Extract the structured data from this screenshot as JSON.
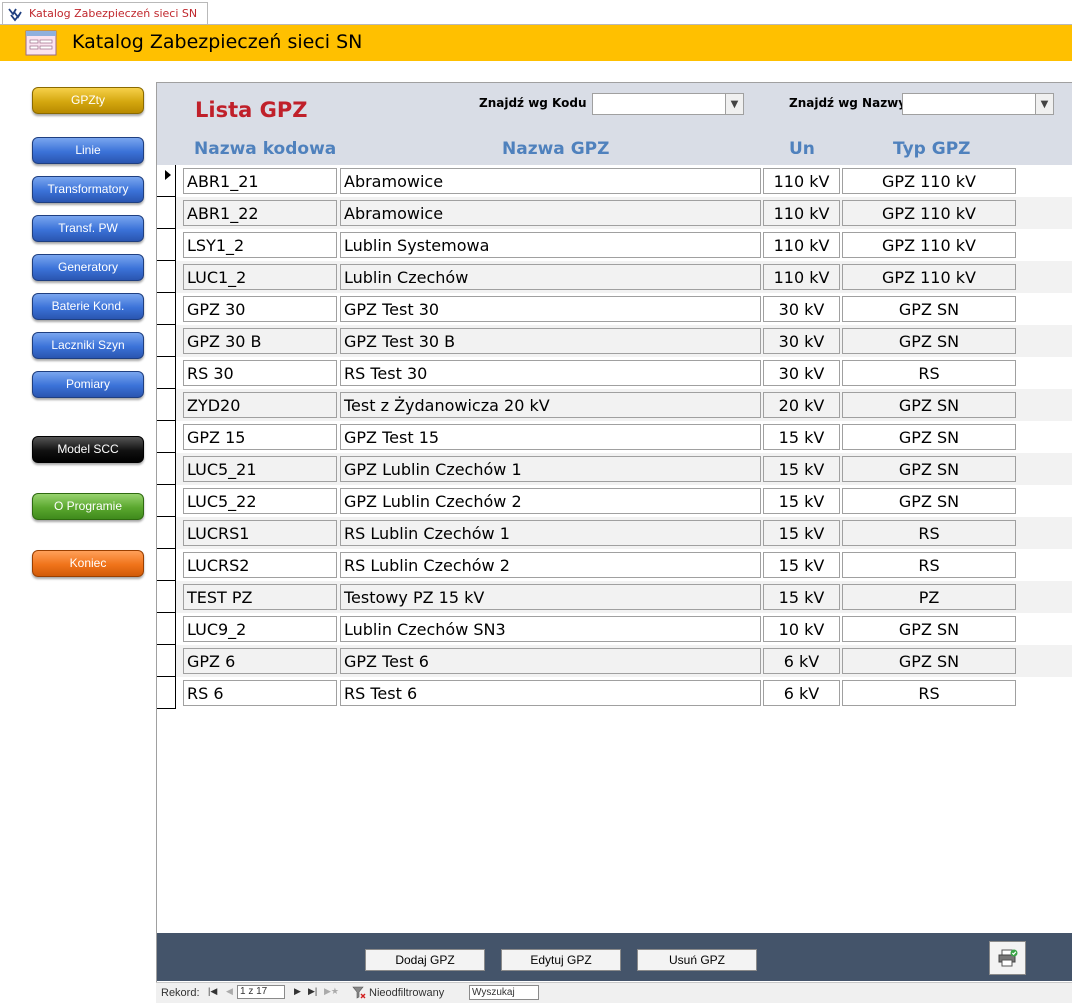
{
  "tab": {
    "label": "Katalog Zabezpieczeń sieci SN"
  },
  "header": {
    "title": "Katalog Zabezpieczeń sieci SN"
  },
  "nav": [
    {
      "label": "GPZty",
      "style": "gold"
    },
    {
      "label": "Linie",
      "style": "blue"
    },
    {
      "label": "Transformatory",
      "style": "blue"
    },
    {
      "label": "Transf. PW",
      "style": "blue"
    },
    {
      "label": "Generatory",
      "style": "blue"
    },
    {
      "label": "Baterie Kond.",
      "style": "blue"
    },
    {
      "label": "Laczniki Szyn",
      "style": "blue"
    },
    {
      "label": "Pomiary",
      "style": "blue"
    },
    {
      "label": "Model SCC",
      "style": "black"
    },
    {
      "label": "O Programie",
      "style": "green"
    },
    {
      "label": "Koniec",
      "style": "orange"
    }
  ],
  "form": {
    "title": "Lista GPZ",
    "find_by_code_label": "Znajdź wg Kodu",
    "find_by_code_value": "",
    "find_by_name_label": "Znajdź wg Nazwy",
    "find_by_name_value": "",
    "columns": [
      "Nazwa kodowa",
      "Nazwa GPZ",
      "Un",
      "Typ GPZ"
    ],
    "rows": [
      [
        "ABR1_21",
        "Abramowice",
        "110 kV",
        "GPZ 110 kV"
      ],
      [
        "ABR1_22",
        "Abramowice",
        "110 kV",
        "GPZ 110 kV"
      ],
      [
        "LSY1_2",
        "Lublin Systemowa",
        "110 kV",
        "GPZ 110 kV"
      ],
      [
        "LUC1_2",
        "Lublin Czechów",
        "110 kV",
        "GPZ 110 kV"
      ],
      [
        "GPZ 30",
        "GPZ Test 30",
        "30 kV",
        "GPZ SN"
      ],
      [
        "GPZ 30 B",
        "GPZ Test 30 B",
        "30 kV",
        "GPZ SN"
      ],
      [
        "RS 30",
        "RS Test 30",
        "30 kV",
        "RS"
      ],
      [
        "ZYD20",
        "Test z Żydanowicza 20 kV",
        "20 kV",
        "GPZ SN"
      ],
      [
        "GPZ 15",
        "GPZ Test 15",
        "15 kV",
        "GPZ SN"
      ],
      [
        "LUC5_21",
        "GPZ Lublin Czechów 1",
        "15 kV",
        "GPZ SN"
      ],
      [
        "LUC5_22",
        "GPZ Lublin Czechów 2",
        "15 kV",
        "GPZ SN"
      ],
      [
        "LUCRS1",
        "RS Lublin Czechów 1",
        "15 kV",
        "RS"
      ],
      [
        "LUCRS2",
        "RS Lublin Czechów 2",
        "15 kV",
        "RS"
      ],
      [
        "TEST PZ",
        "Testowy PZ 15 kV",
        "15 kV",
        "PZ"
      ],
      [
        "LUC9_2",
        "Lublin Czechów SN3",
        "10 kV",
        "GPZ SN"
      ],
      [
        "GPZ 6",
        "GPZ Test 6",
        "6 kV",
        "GPZ SN"
      ],
      [
        "RS 6",
        "RS Test 6",
        "6 kV",
        "RS"
      ]
    ],
    "current_row": 0
  },
  "footer": {
    "add_label": "Dodaj GPZ",
    "edit_label": "Edytuj GPZ",
    "delete_label": "Usuń GPZ",
    "print_icon": "print-preview-icon"
  },
  "record_nav": {
    "label": "Rekord:",
    "position": "1 z 17",
    "filter_label": "Nieodfiltrowany",
    "search_label": "Wyszukaj"
  },
  "colors": {
    "header_bg": "#ffc000",
    "title_red": "#c0202a",
    "column_head_blue": "#4f81bd",
    "form_header_bg": "#d9dde6",
    "footer_bg": "#44546a"
  }
}
